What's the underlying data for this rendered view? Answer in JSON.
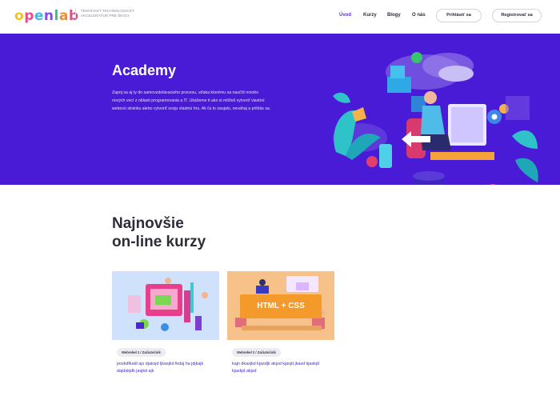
{
  "brand": {
    "logo_letters": [
      {
        "ch": "o",
        "color": "#f2c318"
      },
      {
        "ch": "p",
        "color": "#e94b8b"
      },
      {
        "ch": "e",
        "color": "#47b8e6"
      },
      {
        "ch": "n",
        "color": "#7c4de8"
      },
      {
        "ch": "l",
        "color": "#3fbf7f"
      },
      {
        "ch": "a",
        "color": "#f08c2a"
      },
      {
        "ch": "b",
        "color": "#e94b8b"
      }
    ],
    "tagline": "Tematický technologický akcelerátor pre školy"
  },
  "nav": {
    "items": [
      "Úvod",
      "Kurzy",
      "Blogy",
      "O nás"
    ],
    "active_index": 0,
    "login_label": "Prihlásiť sa",
    "register_label": "Registrovať sa"
  },
  "hero": {
    "title": "Academy",
    "text": "Zapoj sa aj ty do samovzdelávacieho procesu, vďaka ktorému sa naučíš mnoho nových vecí z oblasti programovania a IT. Ukážeme ti ako si môžeš vytvoriť vlastnú webovú stránku alebo vytvoriť svoju vlastnú hru. Ak ťa to zaujalo, neváhaj a prihlás sa."
  },
  "courses": {
    "heading_line1": "Najnovšie",
    "heading_line2": "on-line kurzy",
    "items": [
      {
        "badge": "Webrebel 1 / Začiatočník",
        "title": "poskdfkald ajs djaksjd ljkasjkd lkdaj ha jdjkajk dajdakjdk jasjkd ajk",
        "image_label": ""
      },
      {
        "badge": "Webrebel 2 / Začiatočník",
        "title": "kajn dkasjkd kjasdjk akjsd kjasjd jkasd kjaskjd kjaskjd akjsd",
        "image_label": "HTML + CSS"
      }
    ]
  },
  "colors": {
    "accent": "#5a2fe0",
    "hero_bg": "#4a1bd6",
    "card1_bg": "#cfe1fb",
    "card2_bg": "#f7c289",
    "card_link": "#4a2ad0"
  }
}
